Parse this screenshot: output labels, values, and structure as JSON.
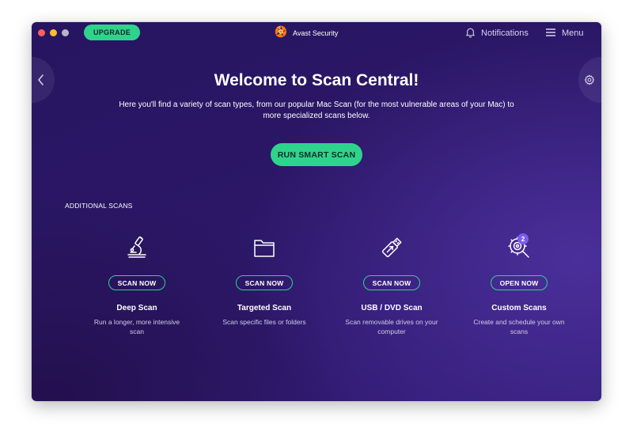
{
  "window": {
    "upgrade_label": "UPGRADE",
    "app_title": "Avast Security",
    "notifications_label": "Notifications",
    "menu_label": "Menu"
  },
  "main": {
    "title": "Welcome to Scan Central!",
    "subtitle": "Here you'll find a variety of scan types, from our popular Mac Scan (for the most vulnerable areas of your Mac) to more specialized scans below.",
    "smart_scan_label": "RUN SMART SCAN",
    "additional_label": "ADDITIONAL SCANS"
  },
  "scans": [
    {
      "title": "Deep Scan",
      "button": "SCAN NOW",
      "desc": "Run a longer, more intensive scan",
      "icon": "microscope-icon"
    },
    {
      "title": "Targeted Scan",
      "button": "SCAN NOW",
      "desc": "Scan specific files or folders",
      "icon": "folder-icon"
    },
    {
      "title": "USB / DVD Scan",
      "button": "SCAN NOW",
      "desc": "Scan removable drives on your computer",
      "icon": "usb-drive-icon"
    },
    {
      "title": "Custom Scans",
      "button": "OPEN NOW",
      "desc": "Create and schedule your own scans",
      "icon": "custom-scan-gear-icon",
      "badge": "2"
    }
  ],
  "colors": {
    "accent_green": "#2ed48c",
    "background_purple": "#2b1766",
    "badge_purple": "#7b5cf0",
    "brand_orange": "#ff7800"
  }
}
